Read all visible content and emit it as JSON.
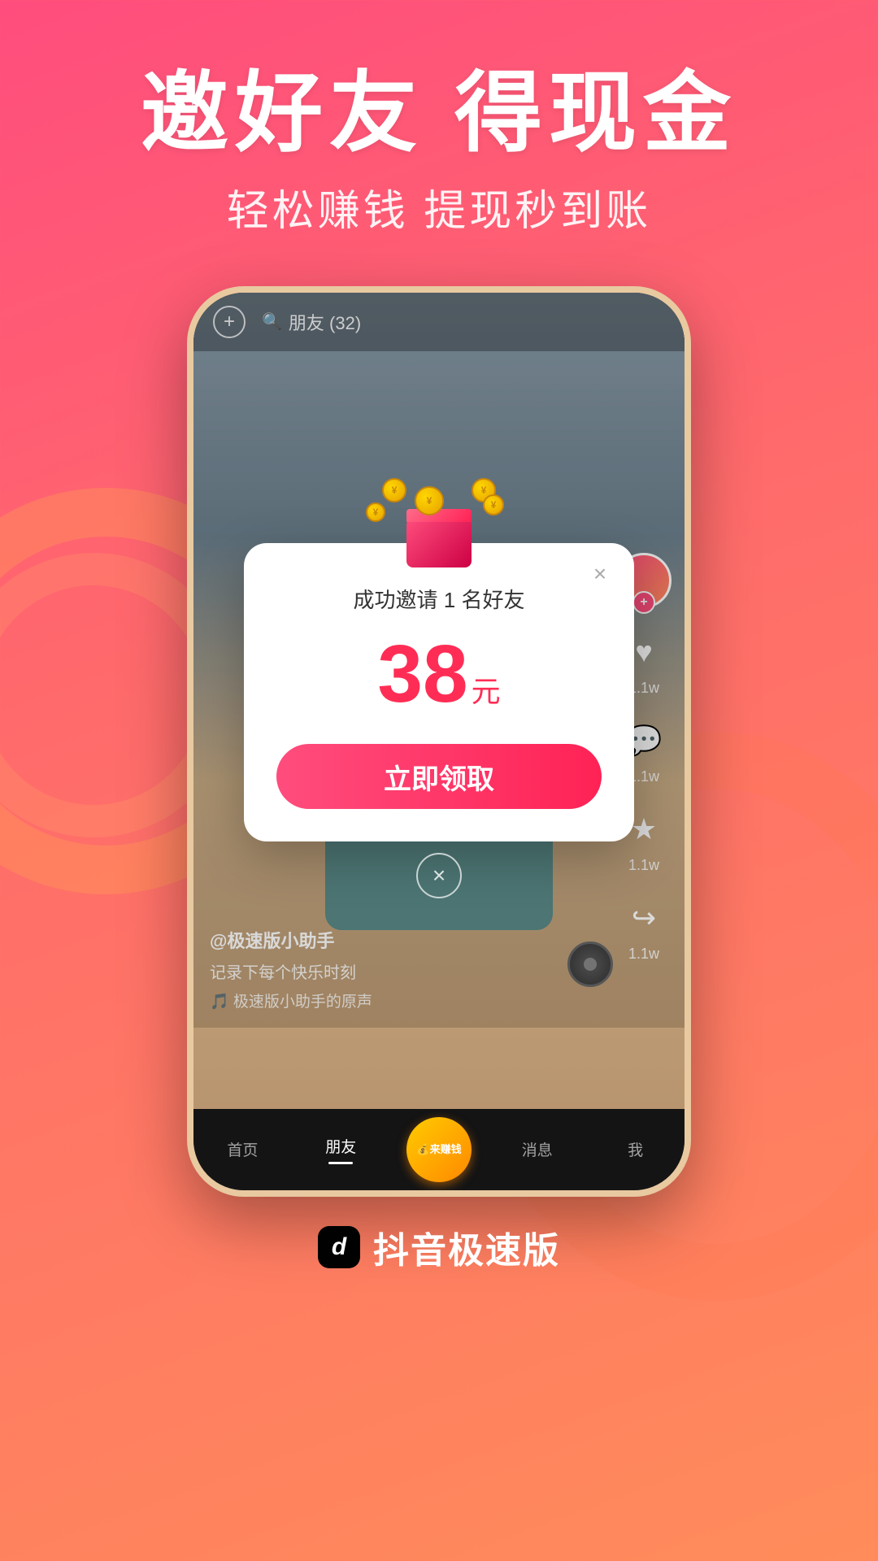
{
  "background": {
    "gradient_start": "#ff4d7d",
    "gradient_end": "#ff8c5a"
  },
  "header": {
    "main_title": "邀好友 得现金",
    "sub_title": "轻松赚钱 提现秒到账"
  },
  "phone": {
    "top_bar": {
      "add_icon": "+",
      "search_icon": "🔍",
      "search_text": "朋友 (32)"
    },
    "right_actions": [
      {
        "icon": "♥",
        "count": "1.1w"
      },
      {
        "icon": "💬",
        "count": "1.1w"
      },
      {
        "icon": "★",
        "count": "1.1w"
      },
      {
        "icon": "↪",
        "count": "1.1w"
      }
    ],
    "video_info": {
      "username": "@极速版小助手",
      "desc": "记录下每个快乐时刻",
      "music": "🎵 极速版小助手的原声"
    },
    "nav": {
      "items": [
        {
          "label": "首页",
          "active": false
        },
        {
          "label": "朋友",
          "active": true
        },
        {
          "label": "来赚钱",
          "active": false,
          "special": true
        },
        {
          "label": "消息",
          "active": false
        },
        {
          "label": "我",
          "active": false
        }
      ]
    }
  },
  "modal": {
    "close_icon": "×",
    "subtitle": "成功邀请 1 名好友",
    "amount": "38",
    "unit": "元",
    "claim_button_label": "立即领取",
    "close_circle_icon": "×"
  },
  "branding": {
    "app_name": "抖音极速版",
    "logo_text": "d"
  }
}
